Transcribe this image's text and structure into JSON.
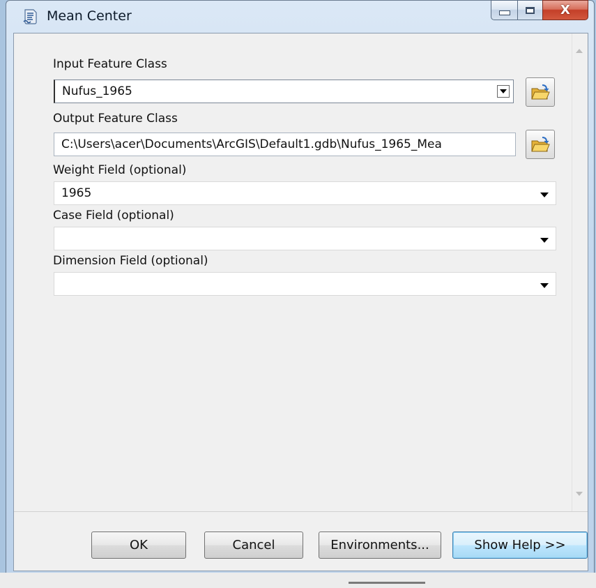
{
  "window": {
    "title": "Mean Center"
  },
  "form": {
    "input_feature_class": {
      "label": "Input Feature Class",
      "value": "Nufus_1965"
    },
    "output_feature_class": {
      "label": "Output Feature Class",
      "value": "C:\\Users\\acer\\Documents\\ArcGIS\\Default1.gdb\\Nufus_1965_Mea"
    },
    "weight_field": {
      "label": "Weight Field (optional)",
      "value": "1965"
    },
    "case_field": {
      "label": "Case Field (optional)",
      "value": ""
    },
    "dimension_field": {
      "label": "Dimension Field (optional)",
      "value": ""
    }
  },
  "buttons": {
    "ok": "OK",
    "cancel": "Cancel",
    "environments": "Environments...",
    "show_help": "Show Help >>"
  },
  "icons": {
    "app": "script-tool-icon",
    "browse": "folder-open-icon"
  }
}
